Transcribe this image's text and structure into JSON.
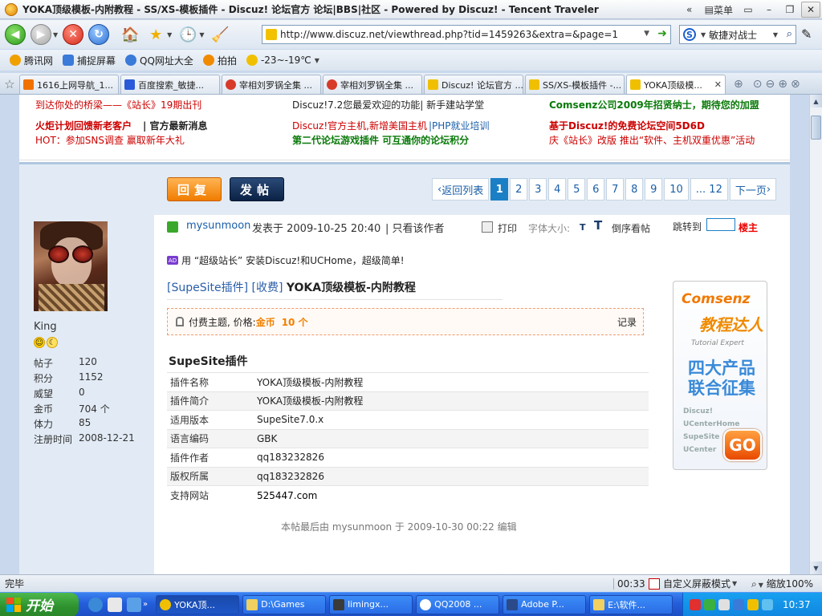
{
  "window": {
    "title": "YOKA顶级模板-内附教程 - SS/XS-模板插件 - Discuz! 论坛官方 论坛|BBS|社区 - Powered by Discuz! - Tencent Traveler",
    "menu_label": "菜单",
    "controls": [
      "«",
      "菜单",
      "▭",
      "–",
      "❐",
      "✕"
    ]
  },
  "nav": {
    "url": "http://www.discuz.net/viewthread.php?tid=1459263&extra=&page=1",
    "search_value": "敏捷对战士"
  },
  "links": [
    {
      "label": "腾讯网",
      "color": "#f0a000"
    },
    {
      "label": "捕捉屏幕",
      "color": "#3a7ad8"
    },
    {
      "label": "QQ网址大全",
      "color": "#3a7ad8"
    },
    {
      "label": "拍拍",
      "color": "#f08a00"
    },
    {
      "label": "-23~-19℃",
      "color": "#f0c000"
    }
  ],
  "tabs": [
    {
      "label": "1616上网导航_1...",
      "color": "#f07000",
      "active": false
    },
    {
      "label": "百度搜索_敏捷...",
      "color": "#2a5ad8",
      "active": false
    },
    {
      "label": "宰相刘罗锅全集 ...",
      "color": "#d83a2a",
      "active": false
    },
    {
      "label": "宰相刘罗锅全集 ...",
      "color": "#d83a2a",
      "active": false
    },
    {
      "label": "Discuz! 论坛官方 ...",
      "color": "#f0c000",
      "active": false
    },
    {
      "label": "SS/XS-模板插件 -...",
      "color": "#f0c000",
      "active": false
    },
    {
      "label": "YOKA顶级模...",
      "color": "#f0c000",
      "active": true
    }
  ],
  "ads": [
    {
      "text": "到达你处的桥梁——《站长》19期出刊",
      "color": "#cc0000",
      "bold": false
    },
    {
      "text": "Discuz!7.2您最爱欢迎的功能| 新手建站学堂",
      "color": "#222222",
      "bold": false
    },
    {
      "text": "Comsenz公司2009年招贤纳士，期待您的加盟",
      "color": "#0a7a0a",
      "bold": true
    },
    {
      "text": "火炬计划回馈新老客户",
      "color": "#cc0000",
      "bold": true
    },
    {
      "text": "| 官方最新消息",
      "color": "#222222",
      "bold": true
    },
    {
      "text": "Discuz!官方主机,新增美国主机",
      "color": "#cc0000",
      "bold": false
    },
    {
      "text": "|PHP就业培训",
      "color": "#1a5ea8",
      "bold": false
    },
    {
      "text": "基于Discuz!的免费论坛空间5D6D",
      "color": "#cc0000",
      "bold": true
    },
    {
      "text": "HOT：参加SNS调查 赢取新年大礼",
      "color": "#cc0000",
      "bold": false
    },
    {
      "text": "第二代论坛游戏插件 可互通你的论坛积分",
      "color": "#0a7a0a",
      "bold": true
    },
    {
      "text": "庆《站长》改版 推出“软件、主机双重优惠”活动",
      "color": "#cc0000",
      "bold": false
    }
  ],
  "toolbar": {
    "reply": "回复",
    "post": "发帖",
    "back_to_list": "返回列表",
    "pages": [
      "1",
      "2",
      "3",
      "4",
      "5",
      "6",
      "7",
      "8",
      "9",
      "10"
    ],
    "current_page": "1",
    "ellipsis_last": "... 12",
    "next": "下一页"
  },
  "author": {
    "name": "King",
    "stats": [
      {
        "label": "帖子",
        "value": "120"
      },
      {
        "label": "积分",
        "value": "1152"
      },
      {
        "label": "威望",
        "value": "0"
      },
      {
        "label": "金币",
        "value": "704 个"
      },
      {
        "label": "体力",
        "value": "85"
      },
      {
        "label": "注册时间",
        "value": "2008-12-21"
      }
    ]
  },
  "post": {
    "user": "mysunmoon",
    "posted_at": "发表于 2009-10-25 20:40",
    "only_author": "| 只看该作者",
    "print": "打印",
    "font_size": "字体大小:",
    "font_small": "T",
    "font_large": "T",
    "reverse": "倒序看帖",
    "jump_to": "跳转到",
    "floor": "楼主",
    "ad_text": "用 “超级站长” 安装Discuz!和UCHome，超级简单!",
    "title_prefix": "[SupeSite插件] [收费]",
    "title": "YOKA顶级模板-内附教程",
    "pay_label": "付费主题, 价格:",
    "pay_currency": "金币",
    "pay_amount": "10 个",
    "record": "记录",
    "section_title": "SupeSite插件",
    "info": [
      {
        "k": "插件名称",
        "v": "YOKA顶级模板-内附教程"
      },
      {
        "k": "插件简介",
        "v": "YOKA顶级模板-内附教程"
      },
      {
        "k": "适用版本",
        "v": "SupeSite7.0.x"
      },
      {
        "k": "语言编码",
        "v": "GBK"
      },
      {
        "k": "插件作者",
        "v": "qq183232826"
      },
      {
        "k": "版权所属",
        "v": "qq183232826"
      },
      {
        "k": "支持网站",
        "v": "525447.com"
      }
    ],
    "edited": "本帖最后由 mysunmoon 于 2009-10-30 00:22 编辑"
  },
  "banner": {
    "brand": "Comsenz",
    "t2": "教程达人",
    "t3": "Tutorial Expert",
    "t4a": "四大产品",
    "t4b": "联合征集",
    "list": [
      "Discuz!",
      "UCenterHome",
      "SupeSite",
      "UCenter"
    ],
    "go": "GO"
  },
  "status": {
    "text": "完毕",
    "time": "00:33",
    "screen_mode": "自定义屏蔽模式",
    "zoom": "缩放100%"
  },
  "taskbar": {
    "start": "开始",
    "tasks": [
      {
        "label": "YOKA顶...",
        "color": "#f0c000",
        "active": true
      },
      {
        "label": "D:\\Games",
        "color": "#f0d060",
        "active": false
      },
      {
        "label": "limingx...",
        "color": "#3a3a3a",
        "active": false
      },
      {
        "label": "QQ2008 ...",
        "color": "#ffffff",
        "active": false
      },
      {
        "label": "Adobe P...",
        "color": "#2a4a8a",
        "active": false
      },
      {
        "label": "E:\\软件...",
        "color": "#f0d060",
        "active": false
      }
    ],
    "clock": "10:37"
  }
}
